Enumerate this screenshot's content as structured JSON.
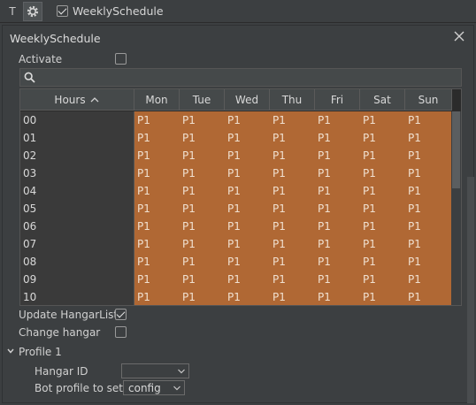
{
  "toolbar": {
    "t_button": "T",
    "title": "WeeklySchedule"
  },
  "panel": {
    "title": "WeeklySchedule",
    "activate_label": "Activate",
    "search_placeholder": "",
    "update_hangarlist_label": "Update HangarList",
    "change_hangar_label": "Change hangar",
    "profile_label": "Profile 1",
    "hangar_id_label": "Hangar ID",
    "hangar_id_value": "",
    "bot_profile_label": "Bot profile to set",
    "bot_profile_value": "config"
  },
  "table": {
    "hours_header": "Hours",
    "days": [
      "Mon",
      "Tue",
      "Wed",
      "Thu",
      "Fri",
      "Sat",
      "Sun"
    ],
    "rows": [
      {
        "hour": "00",
        "cells": [
          "P1",
          "P1",
          "P1",
          "P1",
          "P1",
          "P1",
          "P1"
        ]
      },
      {
        "hour": "01",
        "cells": [
          "P1",
          "P1",
          "P1",
          "P1",
          "P1",
          "P1",
          "P1"
        ]
      },
      {
        "hour": "02",
        "cells": [
          "P1",
          "P1",
          "P1",
          "P1",
          "P1",
          "P1",
          "P1"
        ]
      },
      {
        "hour": "03",
        "cells": [
          "P1",
          "P1",
          "P1",
          "P1",
          "P1",
          "P1",
          "P1"
        ]
      },
      {
        "hour": "04",
        "cells": [
          "P1",
          "P1",
          "P1",
          "P1",
          "P1",
          "P1",
          "P1"
        ]
      },
      {
        "hour": "05",
        "cells": [
          "P1",
          "P1",
          "P1",
          "P1",
          "P1",
          "P1",
          "P1"
        ]
      },
      {
        "hour": "06",
        "cells": [
          "P1",
          "P1",
          "P1",
          "P1",
          "P1",
          "P1",
          "P1"
        ]
      },
      {
        "hour": "07",
        "cells": [
          "P1",
          "P1",
          "P1",
          "P1",
          "P1",
          "P1",
          "P1"
        ]
      },
      {
        "hour": "08",
        "cells": [
          "P1",
          "P1",
          "P1",
          "P1",
          "P1",
          "P1",
          "P1"
        ]
      },
      {
        "hour": "09",
        "cells": [
          "P1",
          "P1",
          "P1",
          "P1",
          "P1",
          "P1",
          "P1"
        ]
      },
      {
        "hour": "10",
        "cells": [
          "P1",
          "P1",
          "P1",
          "P1",
          "P1",
          "P1",
          "P1"
        ]
      }
    ]
  },
  "colors": {
    "cell_fill": "#b06834",
    "background": "#3c3f41"
  }
}
